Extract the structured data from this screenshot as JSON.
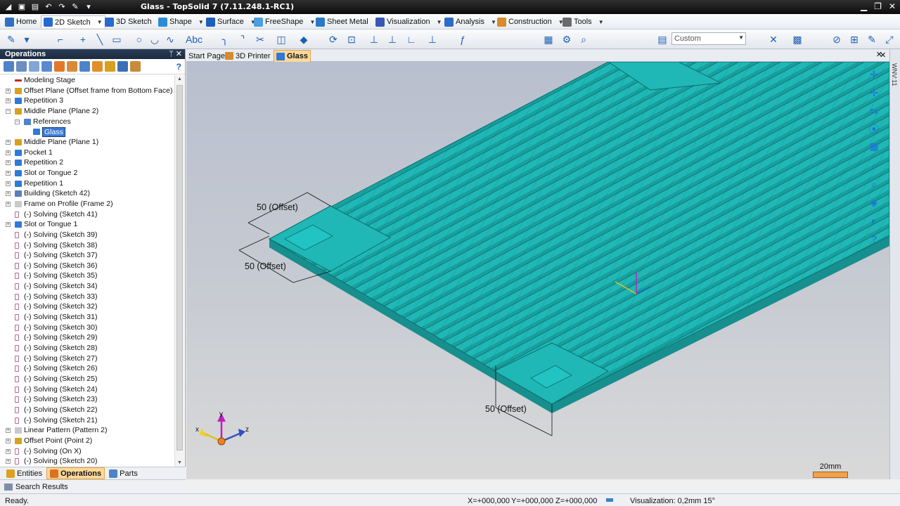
{
  "window": {
    "title": "Glass - TopSolid 7 (7.11.248.1-RC1)",
    "min": "▁",
    "max": "❐",
    "close": "✕"
  },
  "menu": {
    "tabs": [
      {
        "label": "Home",
        "icon": "home-icon",
        "color": "#2f6fc4",
        "active": false
      },
      {
        "label": "2D Sketch",
        "icon": "pencil-icon",
        "color": "#2a6ad0",
        "active": true
      },
      {
        "label": "3D Sketch",
        "icon": "sketch3d-icon",
        "color": "#2a6ad0",
        "active": false
      },
      {
        "label": "Shape",
        "icon": "shape-icon",
        "color": "#2d8bd6",
        "active": false
      },
      {
        "label": "Surface",
        "icon": "surface-icon",
        "color": "#1c5fc0",
        "active": false
      },
      {
        "label": "FreeShape",
        "icon": "freeshape-icon",
        "color": "#4aa0e0",
        "active": false
      },
      {
        "label": "Sheet Metal",
        "icon": "sheetmetal-icon",
        "color": "#2a79c8",
        "active": false
      },
      {
        "label": "Visualization",
        "icon": "visualization-icon",
        "color": "#3a56b5",
        "active": false
      },
      {
        "label": "Analysis",
        "icon": "analysis-icon",
        "color": "#2d6bc8",
        "active": false
      },
      {
        "label": "Construction",
        "icon": "construction-icon",
        "color": "#d98a2b",
        "active": false
      },
      {
        "label": "Tools",
        "icon": "tools-icon",
        "color": "#6b6b6b",
        "active": false
      }
    ]
  },
  "toolbar": {
    "style_combo": "Custom"
  },
  "panel": {
    "title": "Operations",
    "pin": "ᛘ",
    "close": "✕",
    "help": "?",
    "tree": [
      {
        "label": "Modeling Stage",
        "indent": 0,
        "exp": "",
        "color": "#d02020",
        "kind": "arrow"
      },
      {
        "label": "Offset Plane (Offset frame from Bottom Face)",
        "indent": 0,
        "exp": "+",
        "color": "#d6a020",
        "kind": "plane"
      },
      {
        "label": "Repetition 3",
        "indent": 0,
        "exp": "+",
        "color": "#2f7ad6",
        "kind": "rep"
      },
      {
        "label": "Middle Plane (Plane 2)",
        "indent": 0,
        "exp": "−",
        "color": "#d6a020",
        "kind": "plane"
      },
      {
        "label": "References",
        "indent": 1,
        "exp": "−",
        "color": "#4f83c9",
        "kind": "ref"
      },
      {
        "label": "Glass",
        "indent": 2,
        "exp": "",
        "color": "#2f7ad6",
        "kind": "shape",
        "selected": true
      },
      {
        "label": "Middle Plane (Plane 1)",
        "indent": 0,
        "exp": "+",
        "color": "#d6a020",
        "kind": "plane"
      },
      {
        "label": "Pocket 1",
        "indent": 0,
        "exp": "+",
        "color": "#2f7ad6",
        "kind": "shape"
      },
      {
        "label": "Repetition 2",
        "indent": 0,
        "exp": "+",
        "color": "#2f7ad6",
        "kind": "rep"
      },
      {
        "label": "Slot or Tongue 2",
        "indent": 0,
        "exp": "+",
        "color": "#2f7ad6",
        "kind": "shape"
      },
      {
        "label": "Repetition 1",
        "indent": 0,
        "exp": "+",
        "color": "#2f7ad6",
        "kind": "rep"
      },
      {
        "label": "Building (Sketch 42)",
        "indent": 0,
        "exp": "+",
        "color": "#5a7fb8",
        "kind": "sketch"
      },
      {
        "label": "Frame on Profile (Frame 2)",
        "indent": 0,
        "exp": "+",
        "color": "#c9c9c9",
        "kind": "frame"
      },
      {
        "label": "(-) Solving (Sketch 41)",
        "indent": 0,
        "exp": "",
        "color": "#b06a9a",
        "kind": "solve"
      },
      {
        "label": "Slot or Tongue 1",
        "indent": 0,
        "exp": "+",
        "color": "#2f7ad6",
        "kind": "shape"
      },
      {
        "label": "(-) Solving (Sketch 39)",
        "indent": 0,
        "exp": "",
        "color": "#b06a9a",
        "kind": "solve"
      },
      {
        "label": "(-) Solving (Sketch 38)",
        "indent": 0,
        "exp": "",
        "color": "#b06a9a",
        "kind": "solve"
      },
      {
        "label": "(-) Solving (Sketch 37)",
        "indent": 0,
        "exp": "",
        "color": "#b06a9a",
        "kind": "solve"
      },
      {
        "label": "(-) Solving (Sketch 36)",
        "indent": 0,
        "exp": "",
        "color": "#b06a9a",
        "kind": "solve"
      },
      {
        "label": "(-) Solving (Sketch 35)",
        "indent": 0,
        "exp": "",
        "color": "#b06a9a",
        "kind": "solve"
      },
      {
        "label": "(-) Solving (Sketch 34)",
        "indent": 0,
        "exp": "",
        "color": "#b06a9a",
        "kind": "solve"
      },
      {
        "label": "(-) Solving (Sketch 33)",
        "indent": 0,
        "exp": "",
        "color": "#b06a9a",
        "kind": "solve"
      },
      {
        "label": "(-) Solving (Sketch 32)",
        "indent": 0,
        "exp": "",
        "color": "#b06a9a",
        "kind": "solve"
      },
      {
        "label": "(-) Solving (Sketch 31)",
        "indent": 0,
        "exp": "",
        "color": "#b06a9a",
        "kind": "solve"
      },
      {
        "label": "(-) Solving (Sketch 30)",
        "indent": 0,
        "exp": "",
        "color": "#b06a9a",
        "kind": "solve"
      },
      {
        "label": "(-) Solving (Sketch 29)",
        "indent": 0,
        "exp": "",
        "color": "#b06a9a",
        "kind": "solve"
      },
      {
        "label": "(-) Solving (Sketch 28)",
        "indent": 0,
        "exp": "",
        "color": "#b06a9a",
        "kind": "solve"
      },
      {
        "label": "(-) Solving (Sketch 27)",
        "indent": 0,
        "exp": "",
        "color": "#b06a9a",
        "kind": "solve"
      },
      {
        "label": "(-) Solving (Sketch 26)",
        "indent": 0,
        "exp": "",
        "color": "#b06a9a",
        "kind": "solve"
      },
      {
        "label": "(-) Solving (Sketch 25)",
        "indent": 0,
        "exp": "",
        "color": "#b06a9a",
        "kind": "solve"
      },
      {
        "label": "(-) Solving (Sketch 24)",
        "indent": 0,
        "exp": "",
        "color": "#b06a9a",
        "kind": "solve"
      },
      {
        "label": "(-) Solving (Sketch 23)",
        "indent": 0,
        "exp": "",
        "color": "#b06a9a",
        "kind": "solve"
      },
      {
        "label": "(-) Solving (Sketch 22)",
        "indent": 0,
        "exp": "",
        "color": "#b06a9a",
        "kind": "solve"
      },
      {
        "label": "(-) Solving (Sketch 21)",
        "indent": 0,
        "exp": "",
        "color": "#b06a9a",
        "kind": "solve"
      },
      {
        "label": "Linear Pattern (Pattern 2)",
        "indent": 0,
        "exp": "+",
        "color": "#c9c9c9",
        "kind": "pattern"
      },
      {
        "label": "Offset Point (Point 2)",
        "indent": 0,
        "exp": "+",
        "color": "#d6a020",
        "kind": "point"
      },
      {
        "label": "(-) Solving (On X)",
        "indent": 0,
        "exp": "+",
        "color": "#b06a9a",
        "kind": "solve"
      },
      {
        "label": "(-) Solving (Sketch 20)",
        "indent": 0,
        "exp": "+",
        "color": "#b06a9a",
        "kind": "solve"
      }
    ],
    "bottom_tabs": [
      {
        "label": "Entities",
        "color": "#e0a020",
        "active": false
      },
      {
        "label": "Operations",
        "color": "#e07020",
        "active": true
      },
      {
        "label": "Parts",
        "color": "#4f83c9",
        "active": false
      }
    ],
    "search": "Search Results"
  },
  "doc_tabs": [
    {
      "label": "Start Page",
      "color": "",
      "active": false
    },
    {
      "label": "3D Printer",
      "color": "#d98a2b",
      "active": false
    },
    {
      "label": "Glass",
      "color": "#2f7ad6",
      "active": true
    }
  ],
  "viewport": {
    "dimensions": [
      "50 (Offset)",
      "50 (Offset)",
      "50 (Offset)"
    ],
    "scale_label": "20mm",
    "right_strip_label": "WNV:11",
    "axes": {
      "x": "x",
      "y": "y",
      "z": "z"
    },
    "glass_color": "#1fb8b6"
  },
  "status": {
    "ready": "Ready.",
    "x": "X=+000,000",
    "y": "Y=+000,000",
    "z": "Z=+000,000",
    "visualization": "Visualization: 0,2mm 15°"
  }
}
